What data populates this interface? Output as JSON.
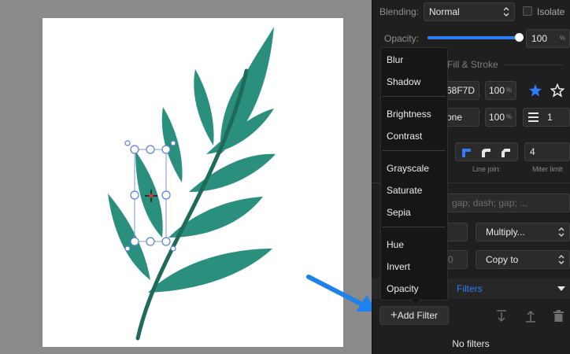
{
  "properties": {
    "blending_label": "Blending:",
    "blending_value": "Normal",
    "isolate_label": "Isolate",
    "opacity_label": "Opacity:",
    "opacity_value": "100",
    "opacity_unit": "%",
    "opacity_fraction": 1.0,
    "fill_stroke_label": "Fill & Stroke",
    "fill_hex": "68F7D",
    "fill_opacity": "100",
    "fill_opacity_unit": "%",
    "stroke_value": "one",
    "stroke_opacity": "100",
    "stroke_opacity_unit": "%",
    "stroke_width": "1",
    "line_join_label": "Line join:",
    "miter_limit_label": "Miter limit",
    "miter_value": "4",
    "dash_placeholder": "gap; dash; gap; ...",
    "blend_mode_value": "Multiply...",
    "copy_value": "Copy to",
    "copy_partial": "0",
    "filters_label": "Filters",
    "add_filter_label": "Add Filter",
    "add_filter_glyph": "+",
    "no_filters_label": "No filters",
    "accent_color": "#2f7df6"
  },
  "filter_menu": {
    "groups": [
      [
        "Blur",
        "Shadow"
      ],
      [
        "Brightness",
        "Contrast"
      ],
      [
        "Grayscale",
        "Saturate",
        "Sepia"
      ],
      [
        "Hue",
        "Invert",
        "Opacity"
      ]
    ]
  },
  "canvas": {
    "artwork": "leaf-branch",
    "leaf_color": "#2a8f7d",
    "stem_color": "#1f6b5a",
    "annotation_arrow_color": "#1e82ea"
  },
  "icons": [
    "star-filled-icon",
    "star-outline-icon",
    "stroke-width-icon",
    "line-join-miter-icon",
    "line-join-round-icon",
    "line-join-bevel-icon",
    "chevron-down-icon",
    "plus-icon",
    "align-bottom-icon",
    "upload-icon",
    "trash-icon"
  ]
}
